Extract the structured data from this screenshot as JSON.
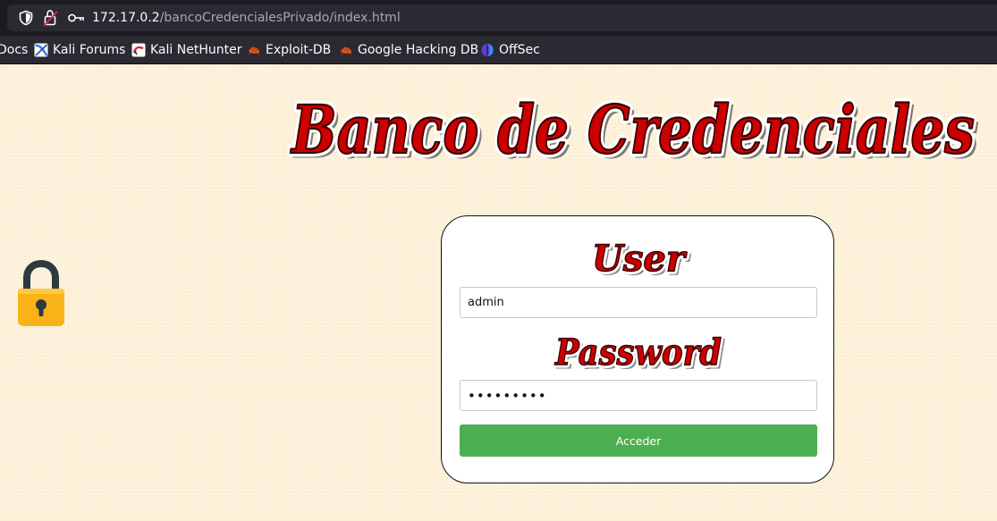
{
  "browser": {
    "url_host": "172.17.0.2",
    "url_path": "/bancoCredencialesPrivado/index.html",
    "bookmarks": [
      {
        "label": "Docs",
        "icon": "docs-icon"
      },
      {
        "label": "Kali Forums",
        "icon": "kali-forums-icon"
      },
      {
        "label": "Kali NetHunter",
        "icon": "kali-nethunter-icon"
      },
      {
        "label": "Exploit-DB",
        "icon": "exploit-db-icon"
      },
      {
        "label": "Google Hacking DB",
        "icon": "google-hacking-db-icon"
      },
      {
        "label": "OffSec",
        "icon": "offsec-icon"
      }
    ]
  },
  "page": {
    "title": "Banco de Credenciales",
    "lock_icon": "padlock-icon",
    "colors": {
      "background": "#fef3dc",
      "title_red": "#cc0000",
      "button_green": "#4caf50"
    }
  },
  "login": {
    "user_heading": "User",
    "username_value": "admin",
    "password_heading": "Password",
    "password_value": "•••••••••",
    "submit_label": "Acceder"
  }
}
